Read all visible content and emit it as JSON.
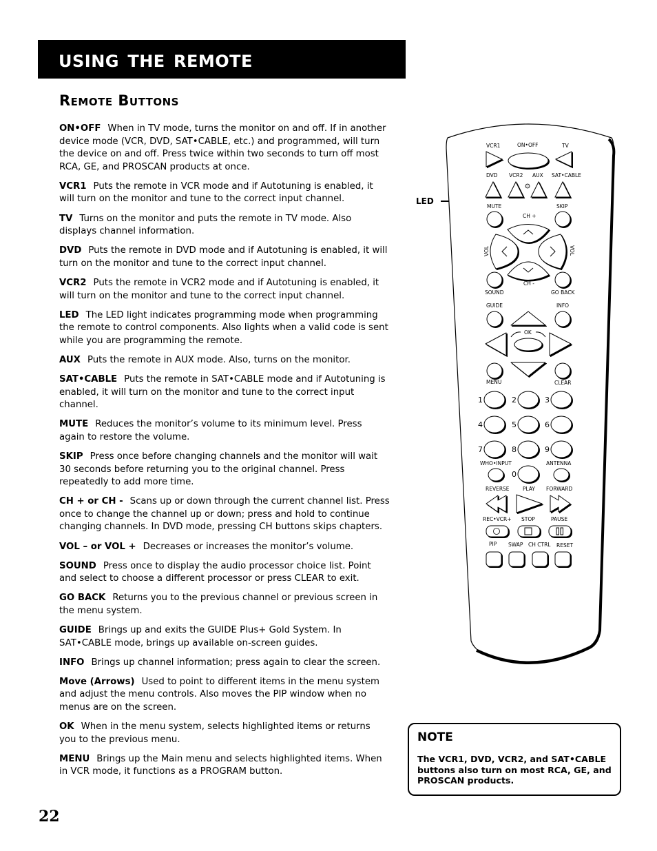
{
  "header": {
    "title": "Using the Remote"
  },
  "section": {
    "title": "Remote Buttons"
  },
  "page_number": "22",
  "descriptions": [
    {
      "term": "ON•OFF",
      "text": "When in TV mode, turns the monitor on and off. If in another device mode (VCR, DVD, SAT•CABLE, etc.) and programmed, will turn the device on and off. Press twice within two seconds to turn off most RCA, GE, and PROSCAN products at once."
    },
    {
      "term": "VCR1",
      "text": "Puts the remote in VCR mode and if Autotuning is enabled, it will turn on the monitor and tune to the correct input channel."
    },
    {
      "term": "TV",
      "text": "Turns on the monitor and puts the remote in TV mode. Also displays channel information."
    },
    {
      "term": "DVD",
      "text": "Puts the remote in DVD mode and if Autotuning is enabled, it will turn on the monitor and tune to the correct input channel."
    },
    {
      "term": "VCR2",
      "text": "Puts the remote in VCR2 mode and if Autotuning is enabled, it will turn on the monitor and tune to the correct input channel."
    },
    {
      "term": "LED",
      "text": "The LED light indicates programming mode when programming the remote to control components. Also lights when a valid code is sent while you are programming the remote."
    },
    {
      "term": "AUX",
      "text": "Puts the remote in AUX mode. Also, turns on the monitor."
    },
    {
      "term": "SAT•CABLE",
      "text": "Puts the remote in SAT•CABLE mode and if Autotuning is enabled, it will turn on the monitor and tune to the correct input channel."
    },
    {
      "term": "MUTE",
      "text": "Reduces the monitor’s volume to its minimum level. Press again to restore the volume."
    },
    {
      "term": "SKIP",
      "text": "Press once before changing channels and the monitor will wait 30 seconds before returning you to the original channel. Press repeatedly to add more time."
    },
    {
      "term": "CH + or CH -",
      "text": "Scans up or down through the current channel list. Press once to change the channel up or down; press and hold to continue changing channels. In DVD mode, pressing CH buttons skips chapters."
    },
    {
      "term": "VOL – or VOL +",
      "text": "Decreases or increases the monitor’s volume."
    },
    {
      "term": "SOUND",
      "text": "Press once to display the audio processor choice list. Point and select to choose a different processor or press CLEAR to exit."
    },
    {
      "term": "GO BACK",
      "text": "Returns you to the previous channel or previous screen in the menu system."
    },
    {
      "term": "GUIDE",
      "text": "Brings up and exits the GUIDE Plus+ Gold System. In SAT•CABLE mode, brings up available on-screen guides."
    },
    {
      "term": "INFO",
      "text": "Brings up channel information; press again to clear the screen."
    },
    {
      "term": "Move (Arrows)",
      "text": "Used to point to different items in the menu system and adjust the menu controls. Also moves the PIP window when no menus are on the screen."
    },
    {
      "term": "OK",
      "text": "When in the menu system, selects highlighted items or returns you to the previous menu."
    },
    {
      "term": "MENU",
      "text": "Brings up the Main menu and selects highlighted items. When in VCR mode, it functions as a PROGRAM button."
    }
  ],
  "note": {
    "title": "NOTE",
    "text": "The VCR1, DVD, VCR2, and SAT•CABLE buttons also turn on most RCA, GE, and PROSCAN products."
  },
  "remote": {
    "led_callout": "LED",
    "labels": {
      "vcr1": "VCR1",
      "on_off": "ON•OFF",
      "tv": "TV",
      "dvd": "DVD",
      "vcr2": "VCR2",
      "aux": "AUX",
      "sat_cable": "SAT•CABLE",
      "mute": "MUTE",
      "skip": "SKIP",
      "ch_plus": "CH +",
      "ch_minus": "CH -",
      "vol_left": "VOL",
      "vol_right": "VOL",
      "sound": "SOUND",
      "go_back": "GO  BACK",
      "guide": "GUIDE",
      "info": "INFO",
      "ok": "OK",
      "menu": "MENU",
      "clear": "CLEAR",
      "who_input": "WHO•INPUT",
      "antenna": "ANTENNA",
      "reverse": "REVERSE",
      "play": "PLAY",
      "forward": "FORWARD",
      "rec_vcr": "REC•VCR+",
      "stop": "STOP",
      "pause": "PAUSE",
      "pip": "PIP",
      "swap": "SWAP",
      "ch_ctrl": "CH CTRL",
      "reset": "RESET"
    },
    "digits": [
      "1",
      "2",
      "3",
      "4",
      "5",
      "6",
      "7",
      "8",
      "9",
      "0"
    ]
  }
}
